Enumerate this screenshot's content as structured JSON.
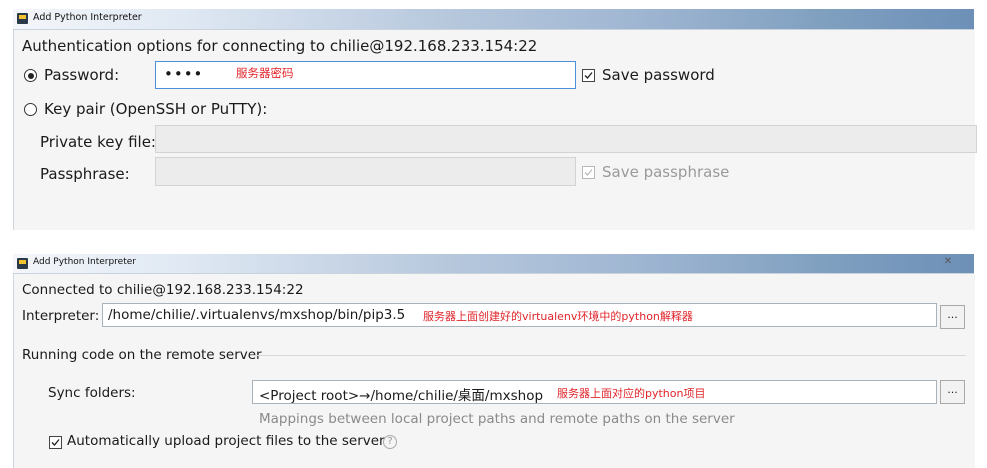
{
  "dialog1": {
    "title": "Add Python Interpreter",
    "heading": "Authentication options for connecting to chilie@192.168.233.154:22",
    "password_label": "Password:",
    "password_value": "••••",
    "password_annotation": "服务器密码",
    "save_password_label": "Save password",
    "keypair_label": "Key pair (OpenSSH or PuTTY):",
    "private_key_label": "Private key file:",
    "passphrase_label": "Passphrase:",
    "save_passphrase_label": "Save passphrase"
  },
  "dialog2": {
    "title": "Add Python Interpreter",
    "connected_label": "Connected to chilie@192.168.233.154:22",
    "interpreter_label": "Interpreter:",
    "interpreter_value": "/home/chilie/.virtualenvs/mxshop/bin/pip3.5",
    "interpreter_annotation": "服务器上面创建好的virtualenv环境中的python解释器",
    "browse_label": "...",
    "section_label": "Running code on the remote server",
    "sync_label": "Sync folders:",
    "sync_value": "<Project root>→/home/chilie/桌面/mxshop",
    "sync_annotation": "服务器上面对应的python项目",
    "sync_browse_label": "...",
    "sync_hint": "Mappings between local project paths and remote paths on the server",
    "auto_upload_label": "Automatically upload project files to the server",
    "help_glyph": "?",
    "close_glyph": "✕"
  },
  "icons": [
    "app-icon",
    "close-icon",
    "help-icon",
    "check-icon"
  ]
}
